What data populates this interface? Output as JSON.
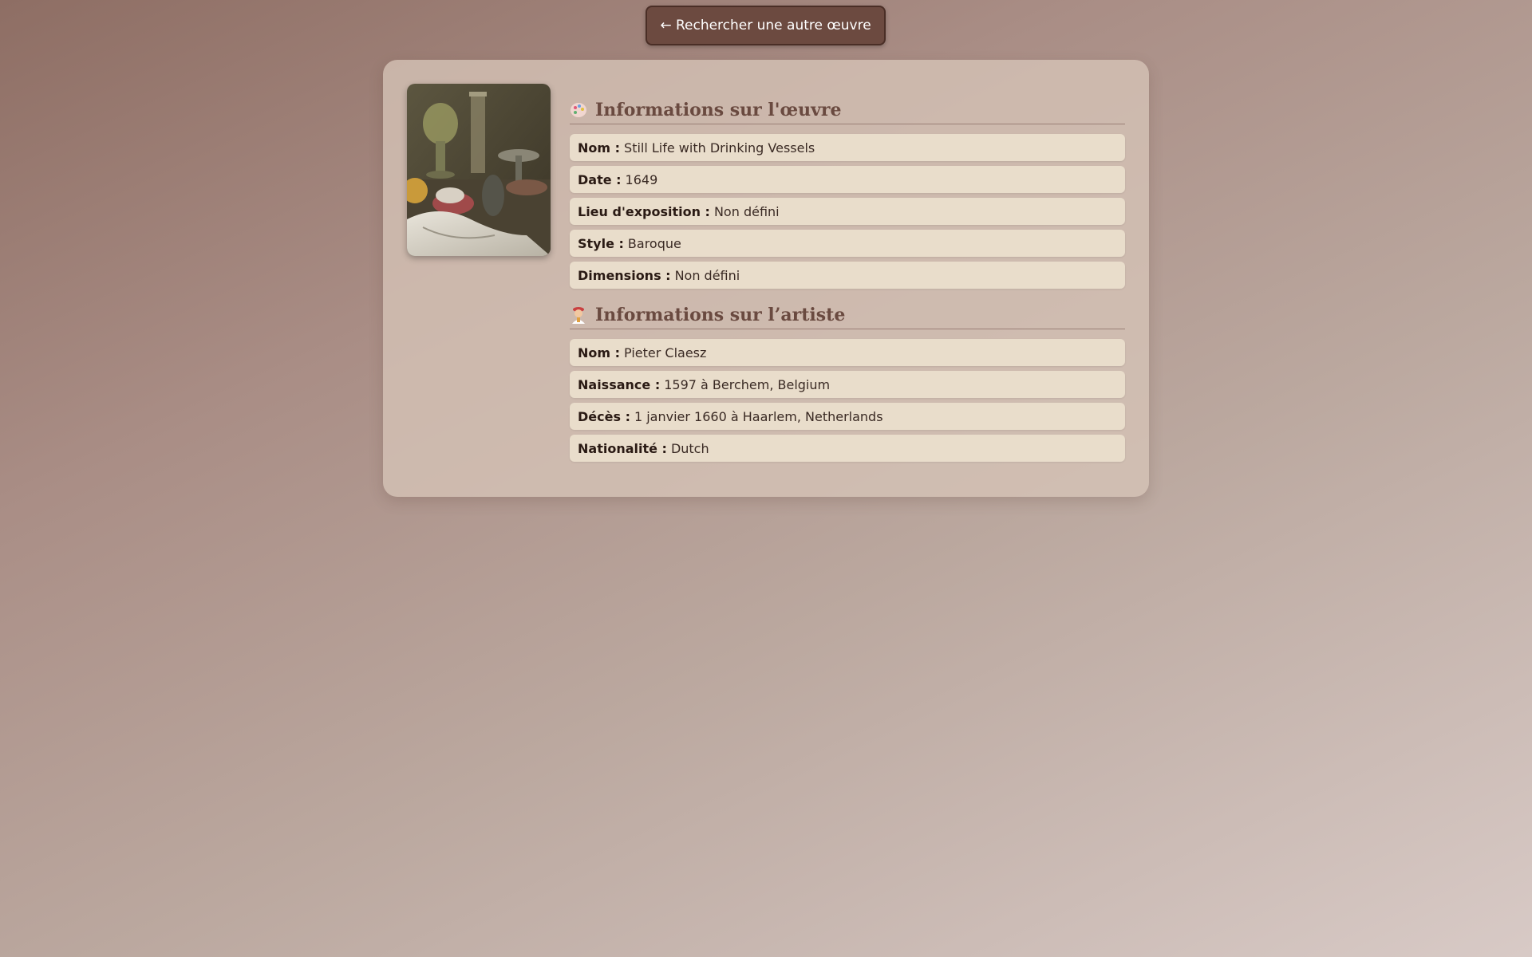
{
  "back_button": {
    "label": "← Rechercher une autre œuvre"
  },
  "artwork_section": {
    "title": "Informations sur l'œuvre",
    "icon": "palette-icon",
    "rows": [
      {
        "label": "Nom :",
        "value": "Still Life with Drinking Vessels"
      },
      {
        "label": "Date :",
        "value": "1649"
      },
      {
        "label": "Lieu d'exposition :",
        "value": "Non défini"
      },
      {
        "label": "Style :",
        "value": "Baroque"
      },
      {
        "label": "Dimensions :",
        "value": "Non défini"
      }
    ]
  },
  "artist_section": {
    "title": "Informations sur l’artiste",
    "icon": "artist-icon",
    "rows": [
      {
        "label": "Nom :",
        "value": "Pieter Claesz"
      },
      {
        "label": "Naissance :",
        "value": "1597 à Berchem, Belgium"
      },
      {
        "label": "Décès :",
        "value": "1 janvier 1660 à Haarlem, Netherlands"
      },
      {
        "label": "Nationalité :",
        "value": "Dutch"
      }
    ]
  },
  "colors": {
    "button_bg": "#6c4a40",
    "card_bg": "#d6c4b7",
    "row_bg": "#e9ddcb",
    "title_color": "#6a4a40"
  }
}
